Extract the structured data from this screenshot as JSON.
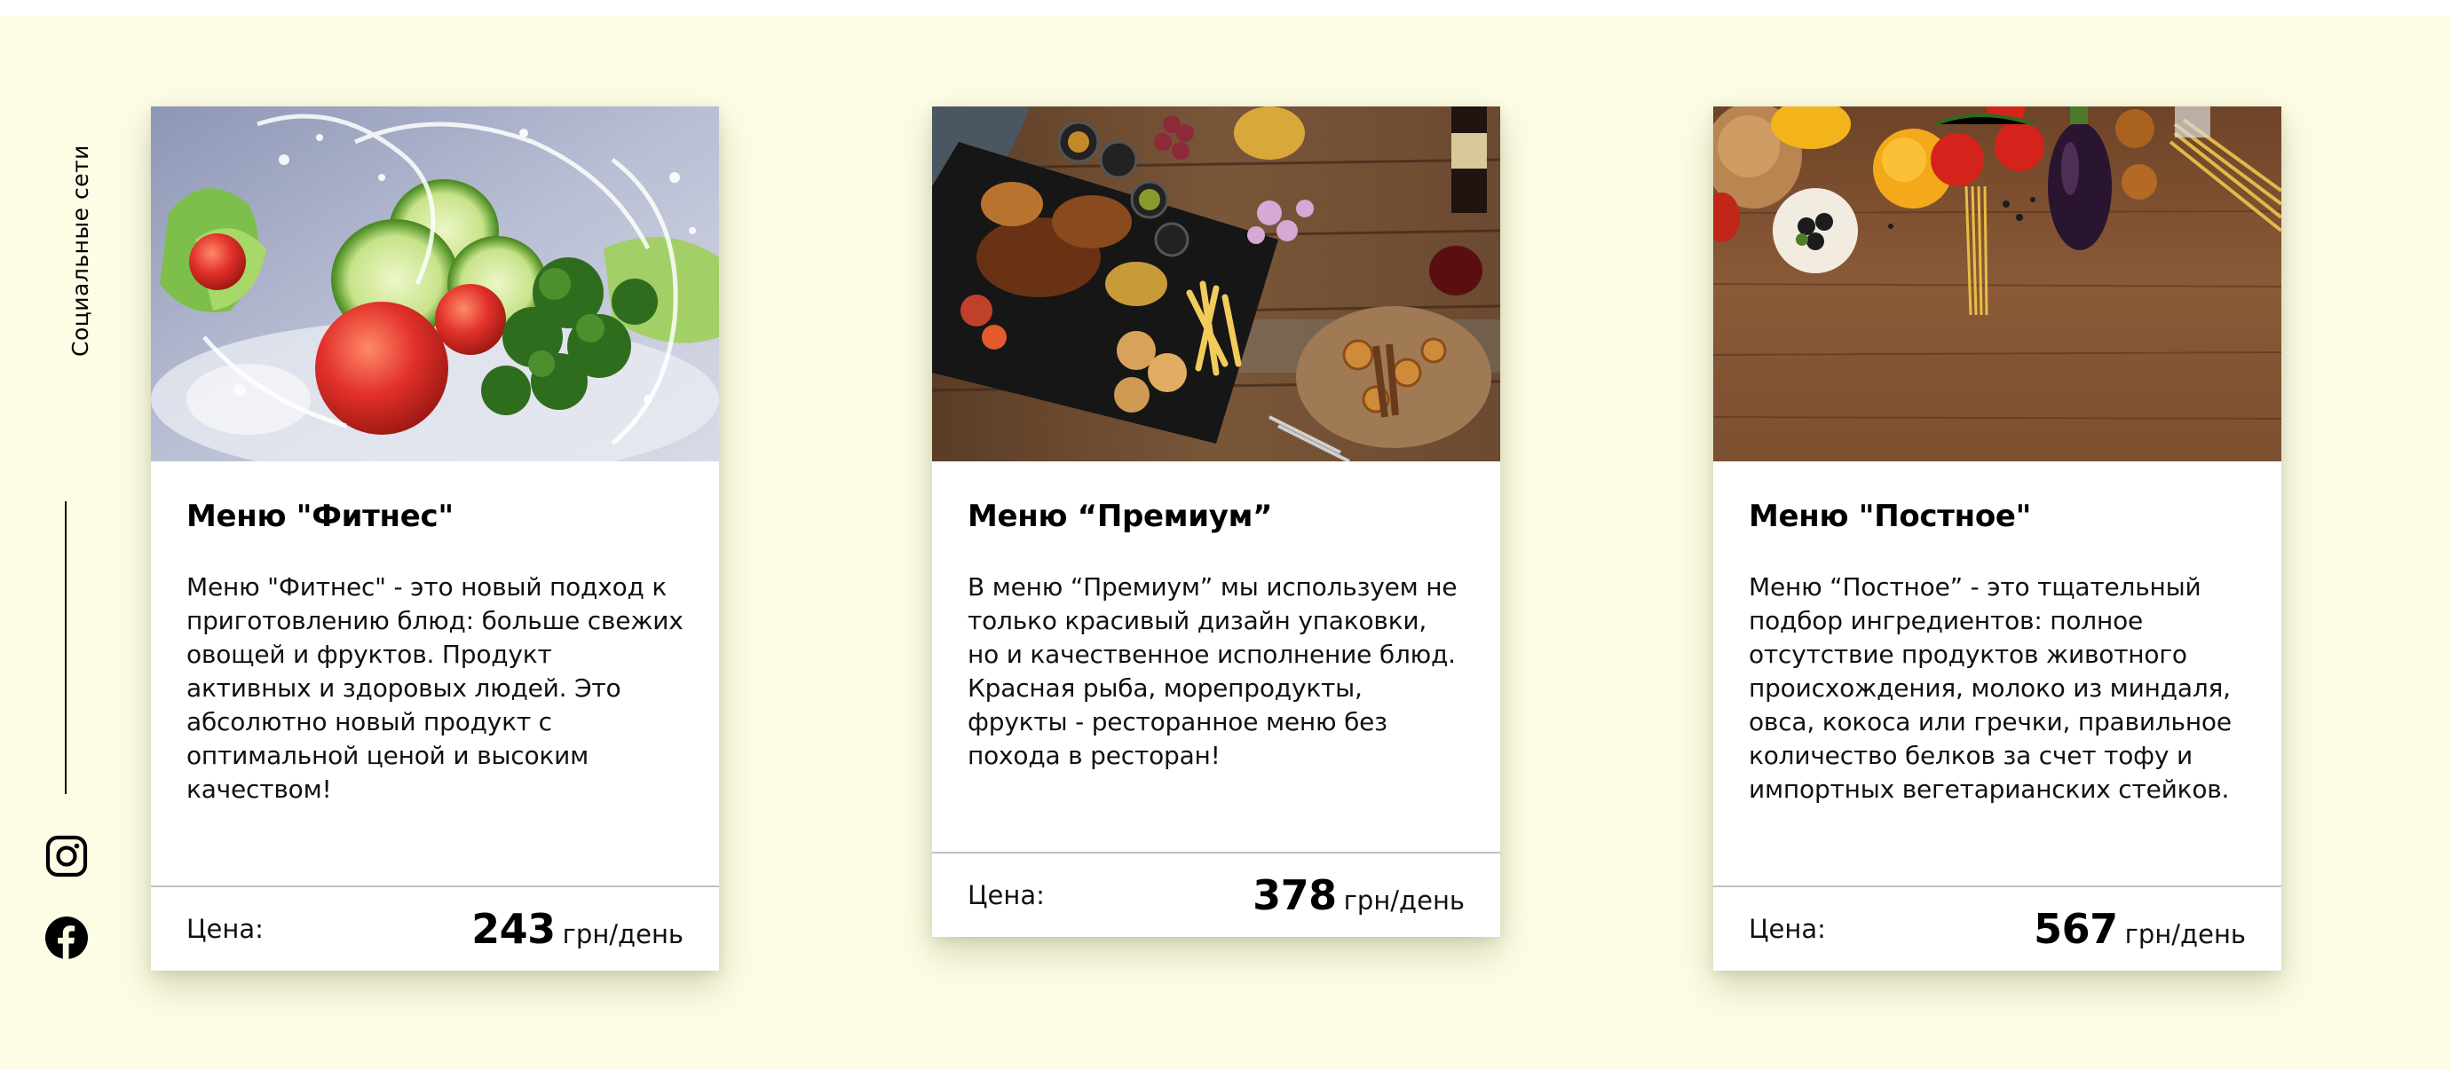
{
  "sidebar": {
    "social_label": "Социальные сети",
    "icons": [
      "instagram-icon",
      "facebook-icon"
    ]
  },
  "cards": [
    {
      "title": "Меню \"Фитнес\"",
      "description": "Меню \"Фитнес\" - это новый подход к приготовлению блюд: больше свежих овощей и фруктов. Продукт активных и здоровых людей. Это абсолютно новый продукт с оптимальной ценой и высоким качеством!",
      "price_label": "Цена:",
      "price_value": "243",
      "price_unit": "грн/день",
      "image": "vegetables-water-splash-photo"
    },
    {
      "title": "Меню “Премиум”",
      "description": "В меню “Премиум” мы используем не только красивый дизайн упаковки, но и качественное исполнение блюд. Красная рыба, морепродукты, фрукты - ресторанное меню без похода в ресторан!",
      "price_label": "Цена:",
      "price_value": "378",
      "price_unit": "грн/день",
      "image": "restaurant-platter-on-wooden-table-photo"
    },
    {
      "title": "Меню \"Постное\"",
      "description": "Меню “Постное” - это тщательный подбор ингредиентов: полное отсутствие продуктов животного происхождения, молоко из миндаля, овса, кокоса или гречки, правильное количество белков за счет тофу и импортных вегетарианских стейков.",
      "price_label": "Цена:",
      "price_value": "567",
      "price_unit": "грн/день",
      "image": "vegetables-and-pasta-on-wooden-board-photo"
    }
  ],
  "colors": {
    "page_background": "#fdfde6",
    "card_background": "#ffffff",
    "text": "#000000",
    "divider": "#c2c2c2"
  }
}
